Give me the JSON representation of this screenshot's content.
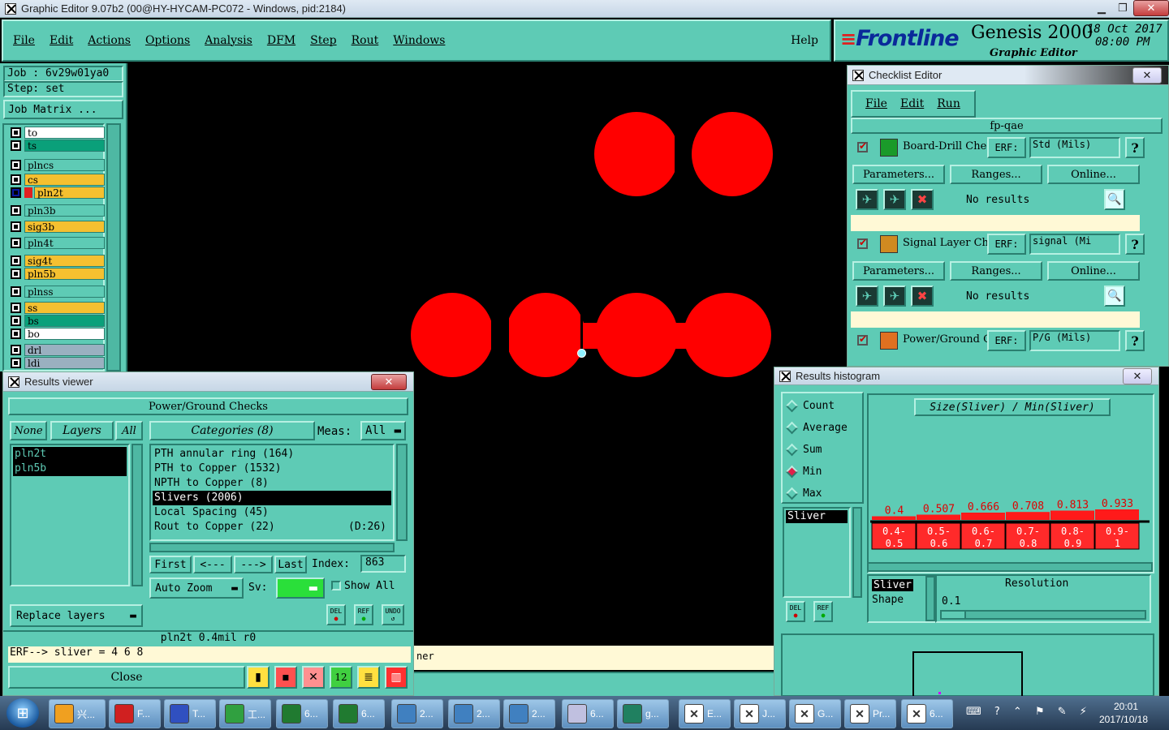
{
  "window": {
    "title": "Graphic Editor 9.07b2 (00@HY-HYCAM-PC072 - Windows, pid:2184)"
  },
  "menubar": {
    "items": [
      "File",
      "Edit",
      "Actions",
      "Options",
      "Analysis",
      "DFM",
      "Step",
      "Rout",
      "Windows"
    ],
    "help": "Help"
  },
  "brand": {
    "logo": "Frontline",
    "product": "Genesis 2000",
    "subtitle": "Graphic Editor",
    "date": "18 Oct 2017",
    "time": "08:00 PM"
  },
  "job": {
    "job": "Job : 6v29w01ya0",
    "step": "Step: set",
    "matrix_button": "Job Matrix ..."
  },
  "layers": [
    {
      "name": "to",
      "color": "#ffffff"
    },
    {
      "name": "ts",
      "color": "#0aa07a"
    },
    {
      "name": "plncs",
      "color": "#5ecbb5"
    },
    {
      "name": "cs",
      "color": "#f5c030"
    },
    {
      "name": "pln2t",
      "color": "#f5c030",
      "selected": true
    },
    {
      "name": "pln3b",
      "color": "#5ecbb5"
    },
    {
      "name": "sig3b",
      "color": "#f5c030"
    },
    {
      "name": "pln4t",
      "color": "#5ecbb5"
    },
    {
      "name": "sig4t",
      "color": "#f5c030"
    },
    {
      "name": "pln5b",
      "color": "#f5c030"
    },
    {
      "name": "plnss",
      "color": "#5ecbb5"
    },
    {
      "name": "ss",
      "color": "#f5c030"
    },
    {
      "name": "bs",
      "color": "#0aa07a"
    },
    {
      "name": "bo",
      "color": "#ffffff"
    },
    {
      "name": "drl",
      "color": "#9ab0c0"
    },
    {
      "name": "ldi",
      "color": "#9ab0c0"
    }
  ],
  "results_viewer": {
    "title": "Results viewer",
    "header": "Power/Ground Checks",
    "none_btn": "None",
    "layers_btn": "Layers",
    "all_btn": "All",
    "categories_btn": "Categories (8)",
    "meas_label": "Meas:",
    "meas_value": "All",
    "layers": [
      "pln2t",
      "pln5b"
    ],
    "categories": [
      {
        "text": "PTH annular ring (164)",
        "extra": ""
      },
      {
        "text": "PTH to Copper (1532)",
        "extra": ""
      },
      {
        "text": "NPTH to Copper (8)",
        "extra": ""
      },
      {
        "text": "Slivers (2006)",
        "extra": "",
        "selected": true
      },
      {
        "text": "Local Spacing (45)",
        "extra": ""
      },
      {
        "text": "Rout to Copper (22)",
        "extra": "(D:26)"
      }
    ],
    "nav": {
      "first": "First",
      "prev": "<---",
      "next": "--->",
      "last": "Last",
      "index_label": "Index:",
      "index_value": "863"
    },
    "auto_zoom": "Auto Zoom",
    "sv_label": "Sv:",
    "show_all": "Show All",
    "replace_layers": "Replace layers",
    "del": "DEL",
    "ref": "REF",
    "undo": "UNDO",
    "status": "pln2t 0.4mil  r0",
    "erf": "ERF--> sliver = 4 6 8",
    "close": "Close"
  },
  "canvas": {
    "bottom_text": "ner"
  },
  "checklist": {
    "title": "Checklist Editor",
    "menu": [
      "File",
      "Edit",
      "Run"
    ],
    "name": "fp-qae",
    "checks": [
      {
        "name": "Board-Drill Che",
        "erf": "ERF:",
        "erf_value": "Std (Mils)",
        "params": "Parameters...",
        "ranges": "Ranges...",
        "online": "Online...",
        "result": "No results",
        "icon_color": "#1a9a2a"
      },
      {
        "name": "Signal Layer Ch",
        "erf": "ERF:",
        "erf_value": "signal (Mi",
        "params": "Parameters...",
        "ranges": "Ranges...",
        "online": "Online...",
        "result": "No results",
        "icon_color": "#d08a20"
      },
      {
        "name": "Power/Ground C",
        "erf": "ERF:",
        "erf_value": "P/G (Mils)",
        "params": "Parameters...",
        "ranges": "Ranges...",
        "online": "Online...",
        "result": "",
        "icon_color": "#e07020"
      }
    ]
  },
  "histogram": {
    "title": "Results histogram",
    "options": [
      {
        "label": "Count",
        "on": false
      },
      {
        "label": "Average",
        "on": false
      },
      {
        "label": "Sum",
        "on": false
      },
      {
        "label": "Min",
        "on": true
      },
      {
        "label": "Max",
        "on": false
      }
    ],
    "list": [
      "Sliver"
    ],
    "chart_title": "Size(Sliver) / Min(Sliver)",
    "bars": [
      {
        "value": "0.4",
        "range": [
          "0.4-",
          "0.5"
        ],
        "level": 0.15
      },
      {
        "value": "0.507",
        "range": [
          "0.5-",
          "0.6"
        ],
        "level": 0.35
      },
      {
        "value": "0.666",
        "range": [
          "0.6-",
          "0.7"
        ],
        "level": 0.6
      },
      {
        "value": "0.708",
        "range": [
          "0.7-",
          "0.8"
        ],
        "level": 0.68
      },
      {
        "value": "0.813",
        "range": [
          "0.8-",
          "0.9"
        ],
        "level": 0.85
      },
      {
        "value": "0.933",
        "range": [
          "0.9-",
          "1"
        ],
        "level": 1.0
      }
    ],
    "shape_label1": "Sliver",
    "shape_label2": "Shape",
    "resolution_label": "Resolution",
    "resolution_value": "0.1",
    "del": "DEL",
    "ref": "REF"
  },
  "taskbar": {
    "items": [
      {
        "label": "兴...",
        "color": "#f0a020"
      },
      {
        "label": "F...",
        "color": "#d02020"
      },
      {
        "label": "T...",
        "color": "#3050c0"
      },
      {
        "label": "工...",
        "color": "#30a040"
      },
      {
        "label": "6...",
        "color": "#207a30"
      },
      {
        "label": "6...",
        "color": "#207a30"
      },
      {
        "label": "2...",
        "color": "#4080c0"
      },
      {
        "label": "2...",
        "color": "#4080c0"
      },
      {
        "label": "2...",
        "color": "#4080c0"
      },
      {
        "label": "6...",
        "color": "#c0c0e0"
      },
      {
        "label": "g...",
        "color": "#208060"
      },
      {
        "label": "E...",
        "color": "#ffffff"
      },
      {
        "label": "J...",
        "color": "#ffffff"
      },
      {
        "label": "G...",
        "color": "#ffffff"
      },
      {
        "label": "Pr...",
        "color": "#ffffff"
      },
      {
        "label": "6...",
        "color": "#ffffff"
      }
    ],
    "time": "20:01",
    "date": "2017/10/18"
  }
}
